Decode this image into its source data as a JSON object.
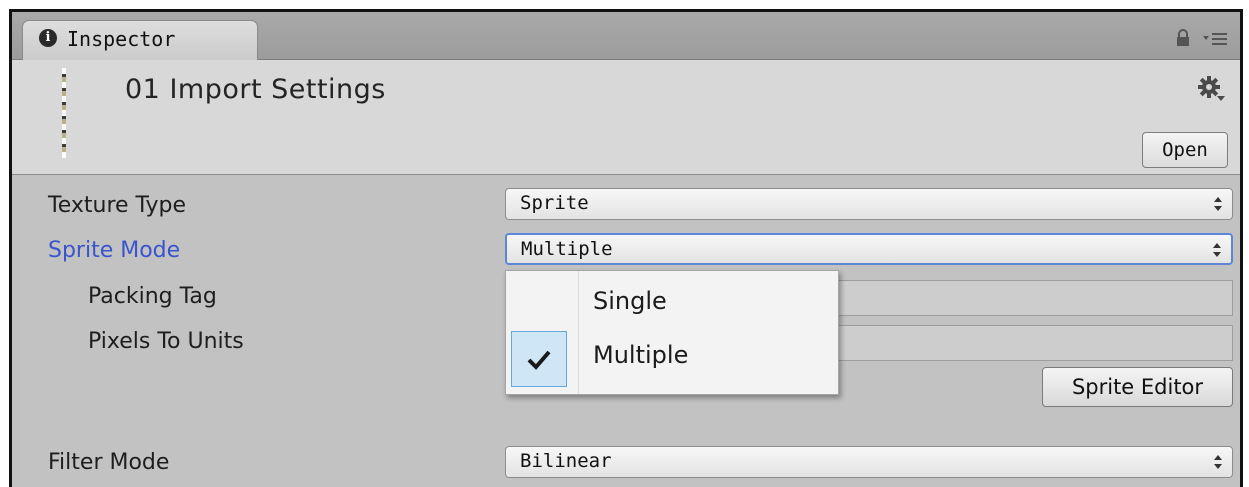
{
  "window": {
    "tab_title": "Inspector",
    "tab_icon": "info-icon",
    "lock_icon": "lock-icon",
    "menu_icon": "menu-icon"
  },
  "header": {
    "asset_title": "01 Import Settings",
    "settings_icon": "gear-icon",
    "open_label": "Open"
  },
  "properties": {
    "texture_type": {
      "label": "Texture Type",
      "value": "Sprite"
    },
    "sprite_mode": {
      "label": "Sprite Mode",
      "value": "Multiple"
    },
    "packing_tag": {
      "label": "Packing Tag",
      "value": ""
    },
    "pixels_to_units": {
      "label": "Pixels To Units",
      "value": ""
    },
    "sprite_editor_label": "Sprite Editor",
    "filter_mode": {
      "label": "Filter Mode",
      "value": "Bilinear"
    }
  },
  "popup": {
    "options": [
      "Single",
      "Multiple"
    ],
    "selected": "Multiple"
  },
  "colors": {
    "highlight_label": "#3a55cc",
    "focus_border": "#5e86d8",
    "check_background": "#cfe6f6"
  }
}
